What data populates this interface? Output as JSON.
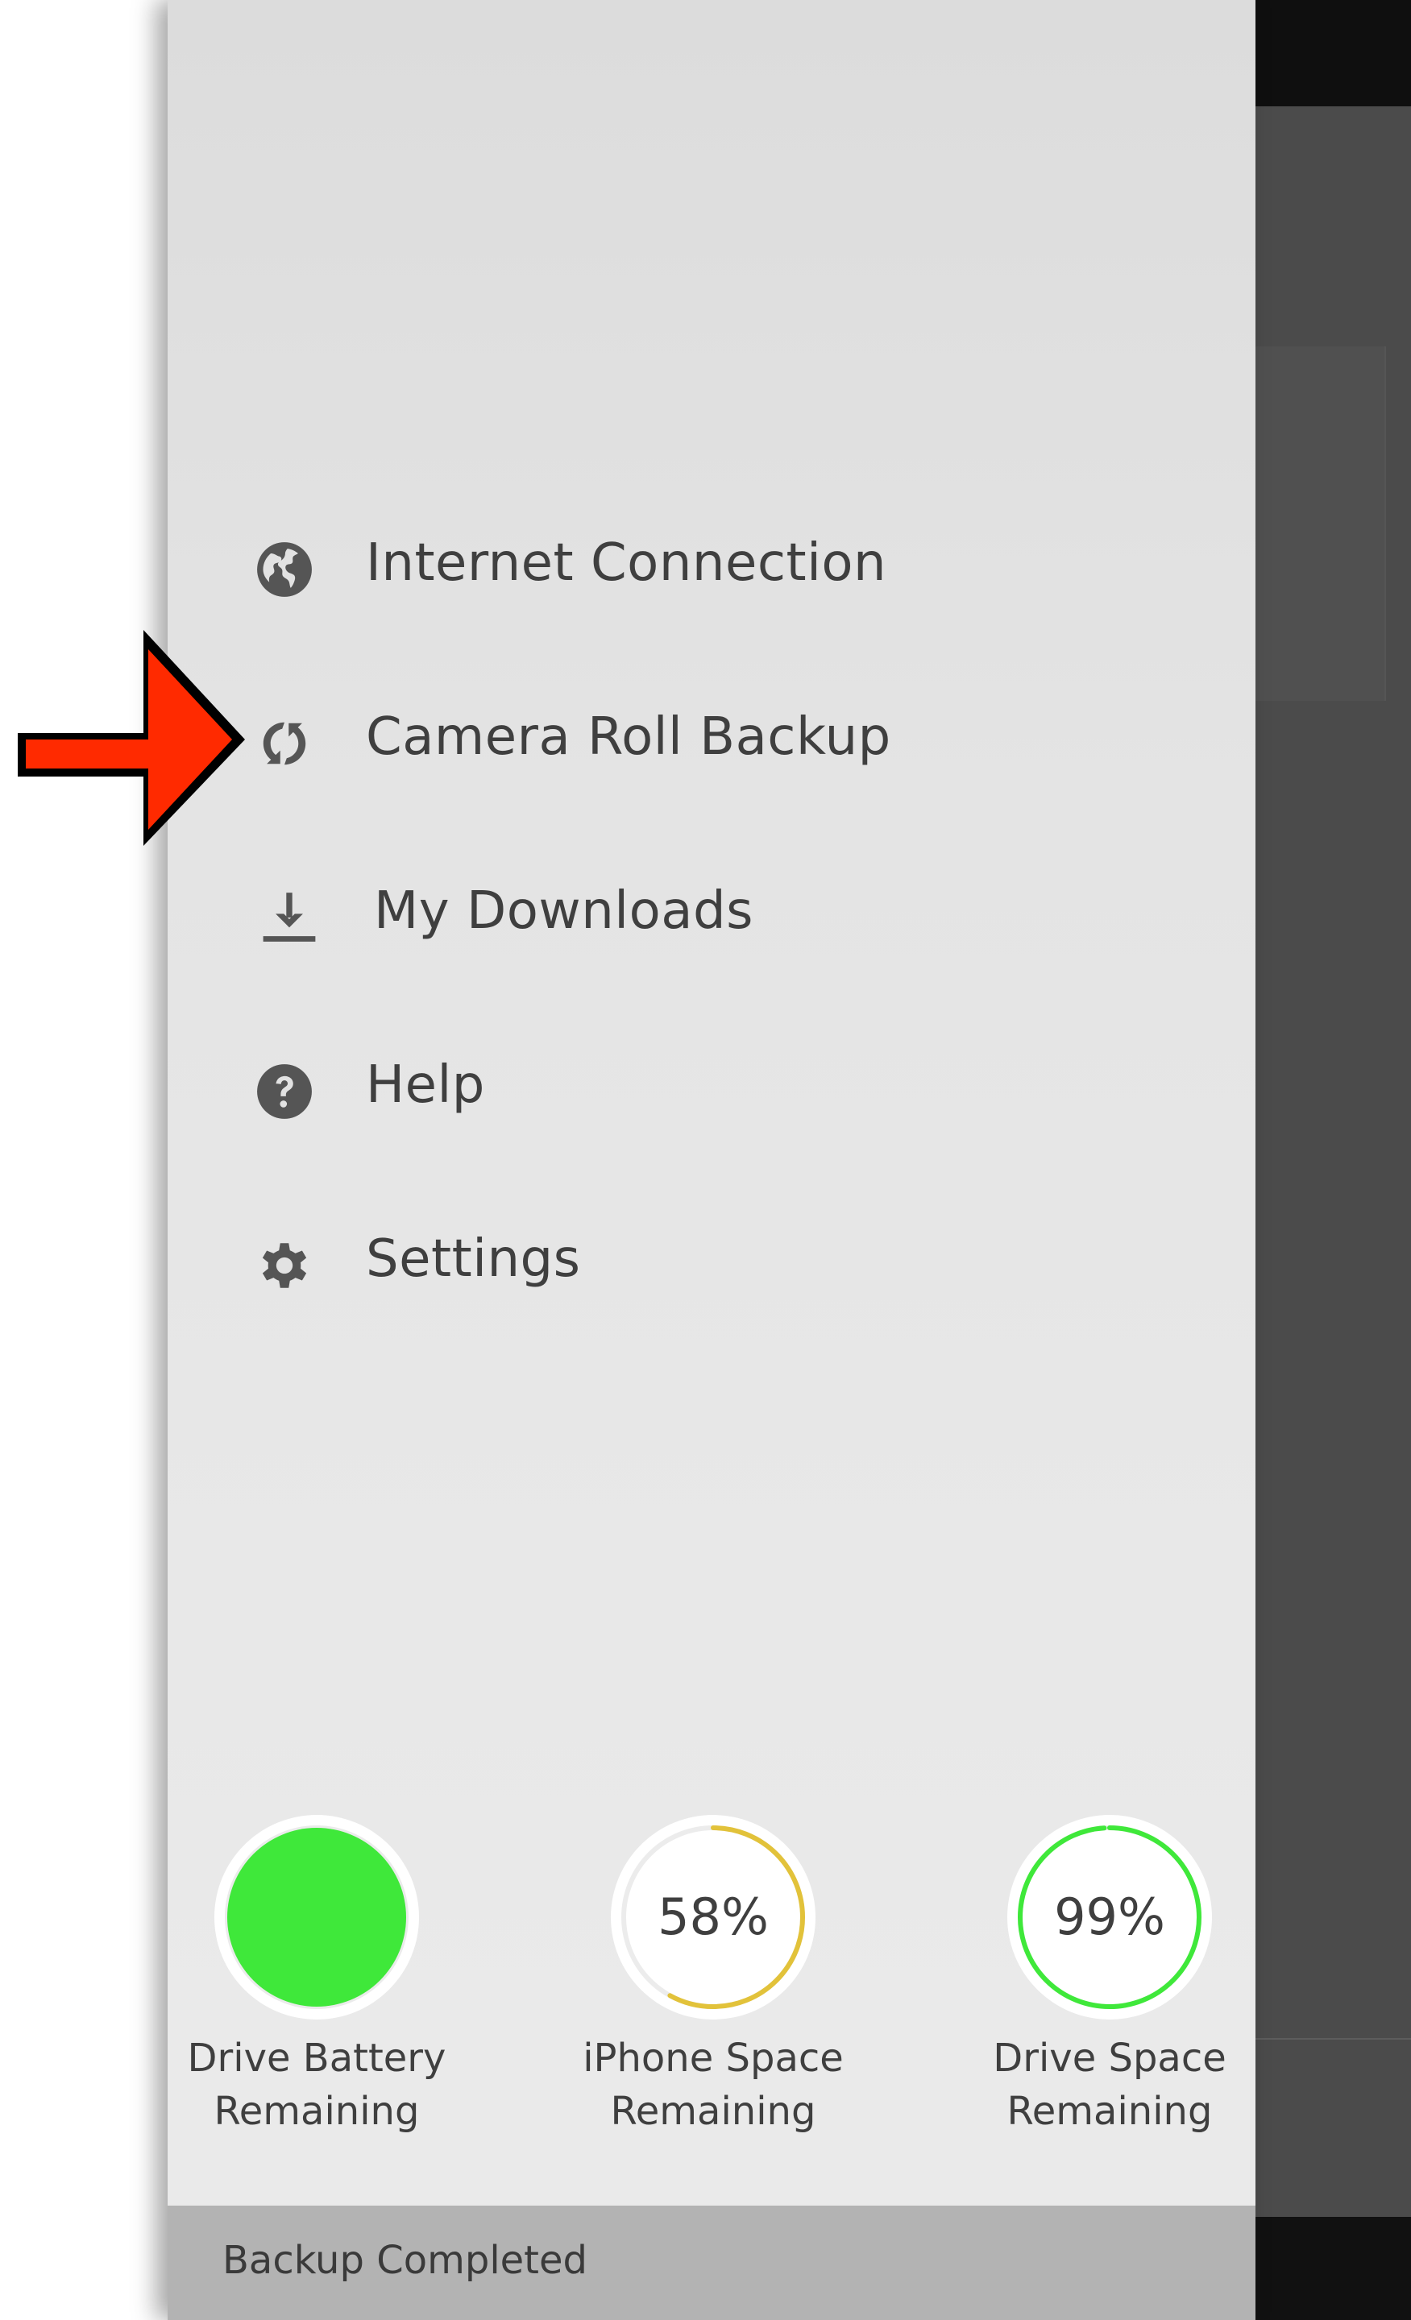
{
  "menu": {
    "items": [
      {
        "label": "Internet Connection",
        "icon": "globe-icon"
      },
      {
        "label": "Camera Roll Backup",
        "icon": "sync-icon"
      },
      {
        "label": "My Downloads",
        "icon": "download-icon"
      },
      {
        "label": "Help",
        "icon": "help-icon"
      },
      {
        "label": "Settings",
        "icon": "gear-icon"
      }
    ]
  },
  "gauges": [
    {
      "line1": "Drive Battery",
      "line2": "Remaining",
      "fraction": 1.0,
      "color": "#3fe83a"
    },
    {
      "percent": "58%",
      "line1": "iPhone Space",
      "line2": "Remaining",
      "fraction": 0.58,
      "color": "#e2c23a"
    },
    {
      "percent": "99%",
      "line1": "Drive Space",
      "line2": "Remaining",
      "fraction": 0.99,
      "color": "#3fe83a"
    }
  ],
  "status": {
    "text": "Backup Completed"
  },
  "colors": {
    "drawer_bg": "#e4e4e4",
    "text": "#3f3f3f",
    "icon": "#555555",
    "arrow": "#ff2a00",
    "status_bar": "#b3b3b3"
  }
}
